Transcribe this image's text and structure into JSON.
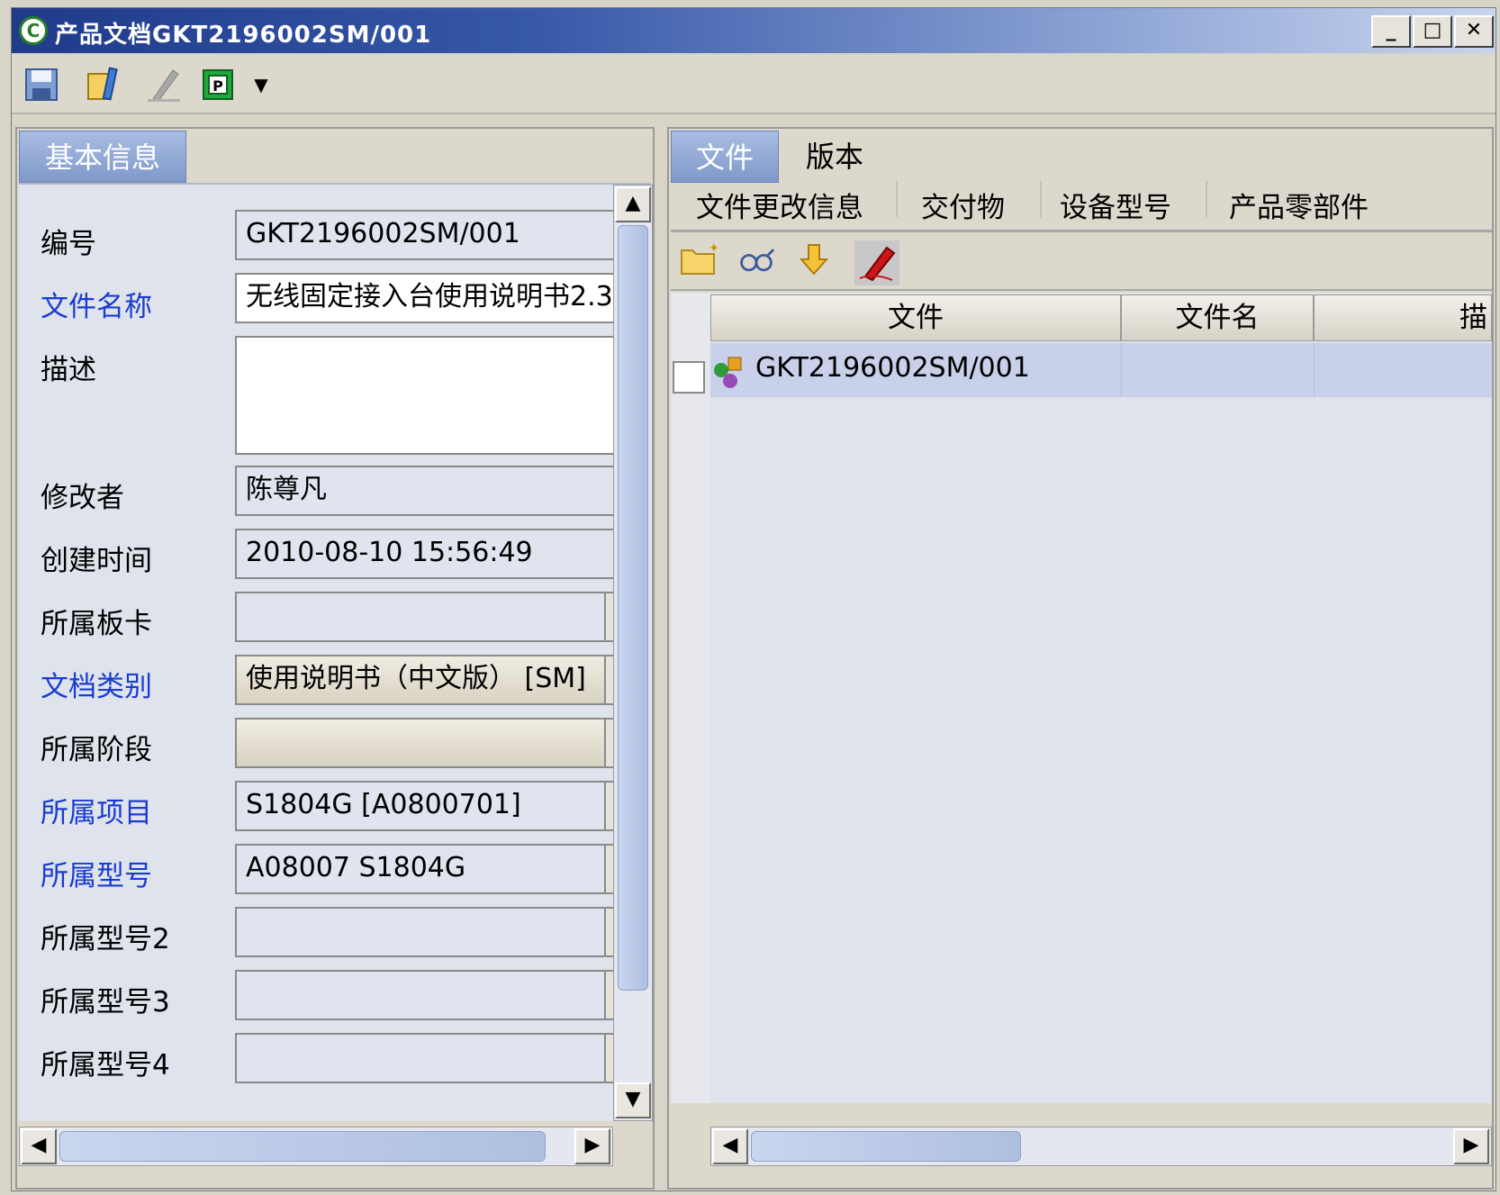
{
  "window": {
    "title": "产品文档GKT2196002SM/001",
    "app_icon_letter": "C",
    "min_label": "_",
    "max_label": "□",
    "close_label": "✕"
  },
  "toolbar": {
    "icons": [
      "save-icon",
      "edit-document-icon",
      "pen-icon",
      "p-box-icon",
      "dropdown-arrow-icon"
    ]
  },
  "left_panel": {
    "tab_label": "基本信息",
    "fields": [
      {
        "label": "编号",
        "value": "GKT2196002SM/001",
        "label_color": "black"
      },
      {
        "label": "文件名称",
        "value": "无线固定接入台使用说明书2.3",
        "label_color": "blue"
      },
      {
        "label": "描述",
        "value": "",
        "label_color": "black"
      },
      {
        "label": "修改者",
        "value": "陈尊凡",
        "label_color": "black"
      },
      {
        "label": "创建时间",
        "value": "2010-08-10 15:56:49",
        "label_color": "black"
      },
      {
        "label": "所属板卡",
        "value": "",
        "label_color": "black"
      },
      {
        "label": "文档类别",
        "value": "使用说明书（中文版） [SM]",
        "label_color": "blue"
      },
      {
        "label": "所属阶段",
        "value": "",
        "label_color": "black"
      },
      {
        "label": "所属项目",
        "value": "S1804G [A0800701]",
        "label_color": "blue"
      },
      {
        "label": "所属型号",
        "value": "A08007 S1804G",
        "label_color": "blue"
      },
      {
        "label": "所属型号2",
        "value": "",
        "label_color": "black"
      },
      {
        "label": "所属型号3",
        "value": "",
        "label_color": "black"
      },
      {
        "label": "所属型号4",
        "value": "",
        "label_color": "black"
      }
    ]
  },
  "right_panel": {
    "tabs": [
      "文件",
      "版本"
    ],
    "subtabs": [
      "文件更改信息",
      "交付物",
      "设备型号",
      "产品零部件"
    ],
    "toolbar_icons": [
      "new-folder-icon",
      "view-glasses-icon",
      "download-arrow-icon",
      "sign-pen-icon"
    ],
    "columns": [
      "文件",
      "文件名",
      "描"
    ],
    "rows": [
      {
        "file": "GKT2196002SM/001",
        "filename": "",
        "desc": ""
      }
    ]
  },
  "colors": {
    "title_start": "#1f3b8a",
    "accent_blue": "#1a3cd0",
    "selected_row": "#c8d0ea"
  }
}
